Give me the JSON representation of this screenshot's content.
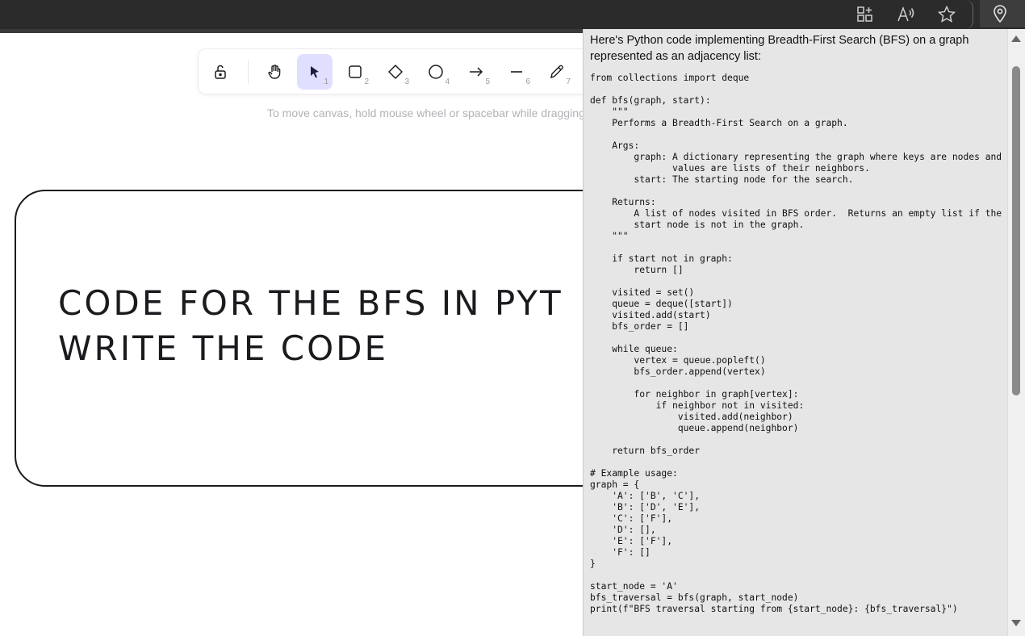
{
  "canvas": {
    "hint": "To move canvas, hold mouse wheel or spacebar while dragging,",
    "card_lines": [
      "CODE FOR THE BFS IN PYT",
      "WRITE THE CODE"
    ]
  },
  "toolbar": {
    "tools": [
      {
        "name": "lock-icon",
        "num": ""
      },
      {
        "name": "hand-icon",
        "num": ""
      },
      {
        "name": "selection-arrow-icon",
        "num": "1"
      },
      {
        "name": "rectangle-icon",
        "num": "2"
      },
      {
        "name": "diamond-icon",
        "num": "3"
      },
      {
        "name": "ellipse-icon",
        "num": "4"
      },
      {
        "name": "arrow-icon",
        "num": "5"
      },
      {
        "name": "line-icon",
        "num": "6"
      },
      {
        "name": "pencil-icon",
        "num": "7"
      }
    ]
  },
  "browser": {
    "icons": [
      "apps-icon",
      "read-aloud-icon",
      "star-icon",
      "location-pin-icon"
    ]
  },
  "panel": {
    "intro": "Here's Python code implementing Breadth-First Search (BFS) on a graph represented as an adjacency list:",
    "code": "from collections import deque\n\ndef bfs(graph, start):\n    \"\"\"\n    Performs a Breadth-First Search on a graph.\n\n    Args:\n        graph: A dictionary representing the graph where keys are nodes and\n               values are lists of their neighbors.\n        start: The starting node for the search.\n\n    Returns:\n        A list of nodes visited in BFS order.  Returns an empty list if the\n        start node is not in the graph.\n    \"\"\"\n\n    if start not in graph:\n        return []\n\n    visited = set()\n    queue = deque([start])\n    visited.add(start)\n    bfs_order = []\n\n    while queue:\n        vertex = queue.popleft()\n        bfs_order.append(vertex)\n\n        for neighbor in graph[vertex]:\n            if neighbor not in visited:\n                visited.add(neighbor)\n                queue.append(neighbor)\n\n    return bfs_order\n\n# Example usage:\ngraph = {\n    'A': ['B', 'C'],\n    'B': ['D', 'E'],\n    'C': ['F'],\n    'D': [],\n    'E': ['F'],\n    'F': []\n}\n\nstart_node = 'A'\nbfs_traversal = bfs(graph, start_node)\nprint(f\"BFS traversal starting from {start_node}: {bfs_traversal}\")"
  }
}
